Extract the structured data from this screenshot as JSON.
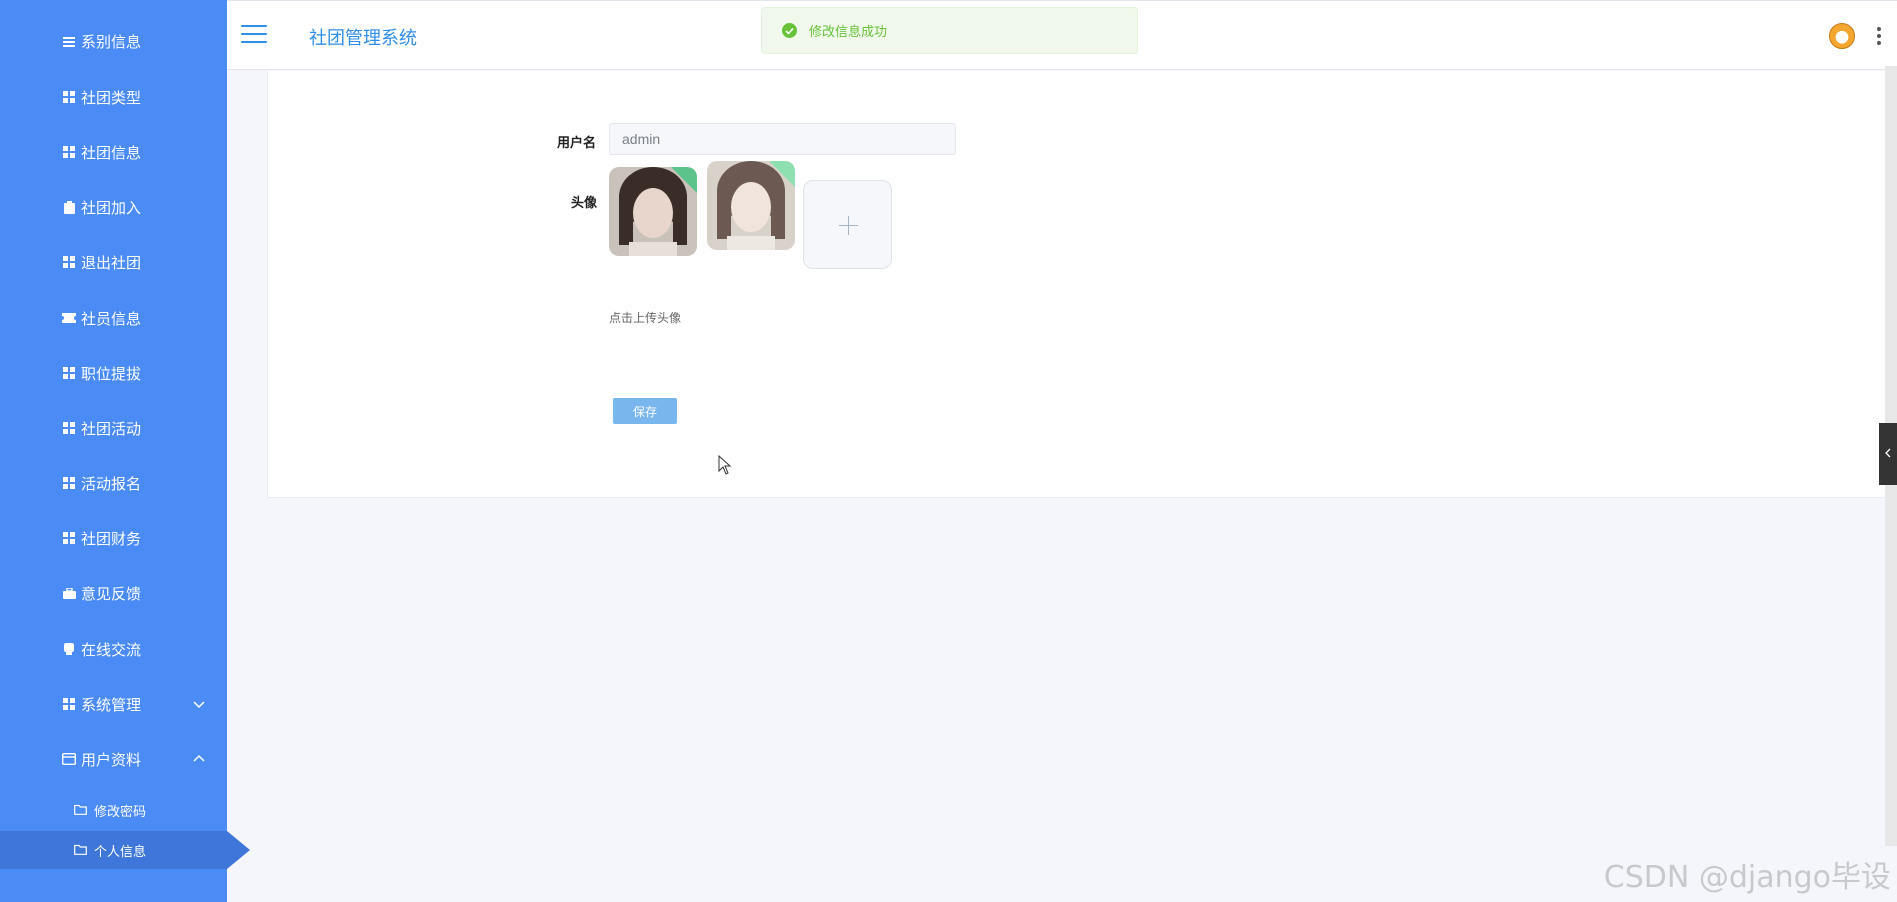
{
  "sidebar": {
    "items": [
      {
        "label": "系别信息",
        "icon": "list-icon"
      },
      {
        "label": "社团类型",
        "icon": "grid-icon"
      },
      {
        "label": "社团信息",
        "icon": "grid-icon"
      },
      {
        "label": "社团加入",
        "icon": "clipboard-icon"
      },
      {
        "label": "退出社团",
        "icon": "grid-icon"
      },
      {
        "label": "社员信息",
        "icon": "ticket-icon"
      },
      {
        "label": "职位提拔",
        "icon": "grid-icon"
      },
      {
        "label": "社团活动",
        "icon": "grid-icon"
      },
      {
        "label": "活动报名",
        "icon": "grid-icon"
      },
      {
        "label": "社团财务",
        "icon": "grid-icon"
      },
      {
        "label": "意见反馈",
        "icon": "briefcase-icon"
      },
      {
        "label": "在线交流",
        "icon": "chat-icon"
      },
      {
        "label": "系统管理",
        "icon": "grid-icon"
      },
      {
        "label": "用户资料",
        "icon": "window-icon"
      }
    ],
    "sub_items": [
      {
        "label": "修改密码",
        "icon": "folder-icon"
      },
      {
        "label": "个人信息",
        "icon": "folder-icon"
      }
    ],
    "colors": {
      "background": "#4a8bf5",
      "active": "#3f76d9"
    }
  },
  "header": {
    "title": "社团管理系统"
  },
  "toast": {
    "message": "修改信息成功",
    "color": "#67c23a"
  },
  "form": {
    "username_label": "用户名",
    "username_value": "admin",
    "avatar_label": "头像",
    "upload_hint": "点击上传头像",
    "save_label": "保存"
  },
  "watermark": "CSDN @django毕设"
}
